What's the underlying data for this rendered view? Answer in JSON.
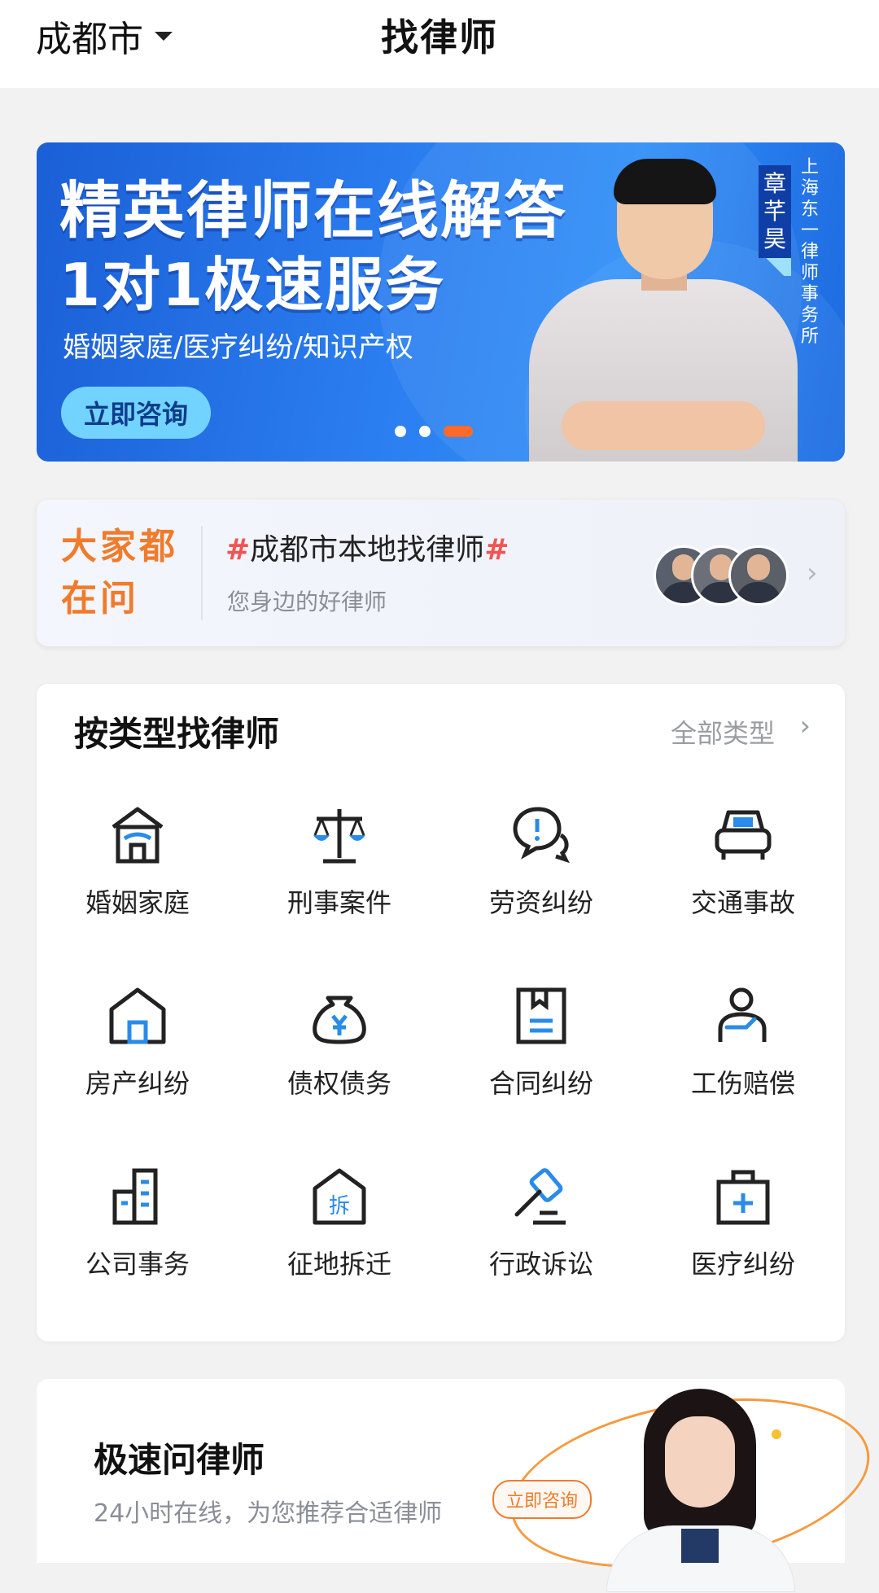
{
  "header": {
    "city": "成都市",
    "title": "找律师"
  },
  "banner": {
    "headline1": "精英律师在线解答",
    "headline2": "1对1极速服务",
    "subtitle": "婚姻家庭/医疗纠纷/知识产权",
    "cta_label": "立即咨询",
    "lawyer_name": "章芊昊",
    "firm": "上海东一律师事务所",
    "slides": 3,
    "active_slide": 3,
    "colors": {
      "accent": "#ff6a2a",
      "cta_bg": "#73d3ff"
    }
  },
  "trending": {
    "label": "大家都在问",
    "hash": "#",
    "topic": "成都市本地找律师",
    "description": "您身边的好律师"
  },
  "types": {
    "title": "按类型找律师",
    "all_label": "全部类型",
    "items": [
      {
        "label": "婚姻家庭",
        "icon": "marriage-home-icon"
      },
      {
        "label": "刑事案件",
        "icon": "scales-icon"
      },
      {
        "label": "劳资纠纷",
        "icon": "speech-exclamation-icon"
      },
      {
        "label": "交通事故",
        "icon": "car-icon"
      },
      {
        "label": "房产纠纷",
        "icon": "house-icon"
      },
      {
        "label": "债权债务",
        "icon": "money-bag-icon"
      },
      {
        "label": "合同纠纷",
        "icon": "contract-icon"
      },
      {
        "label": "工伤赔偿",
        "icon": "injured-worker-icon"
      },
      {
        "label": "公司事务",
        "icon": "office-building-icon"
      },
      {
        "label": "征地拆迁",
        "icon": "demolition-icon"
      },
      {
        "label": "行政诉讼",
        "icon": "gavel-icon"
      },
      {
        "label": "医疗纠纷",
        "icon": "medical-kit-icon"
      }
    ]
  },
  "fast_ask": {
    "title": "极速问律师",
    "subtitle": "24小时在线，为您推荐合适律师",
    "cta_label": "立即咨询"
  }
}
